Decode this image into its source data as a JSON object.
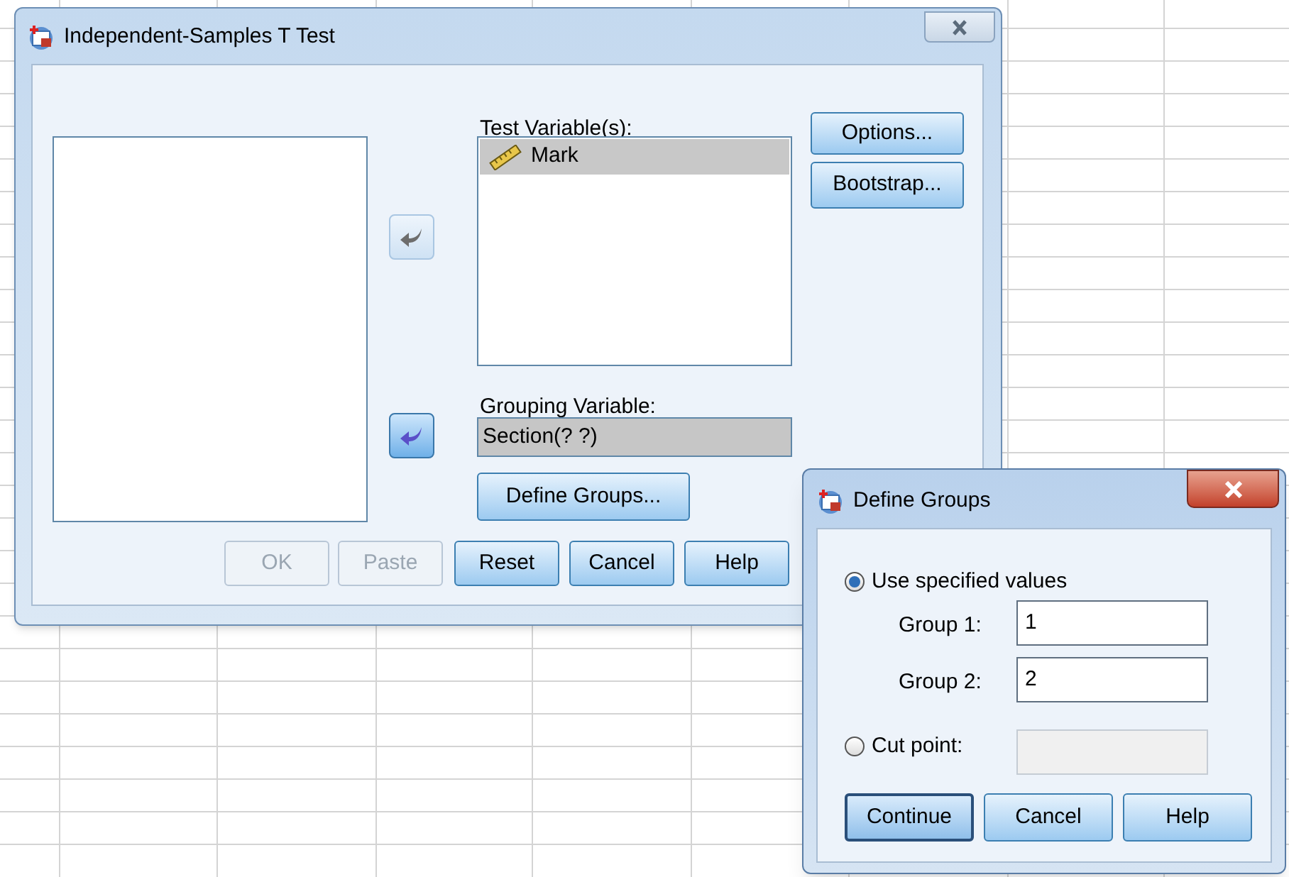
{
  "main_dialog": {
    "title": "Independent-Samples T Test",
    "test_variables": {
      "label": "Test Variable(s):",
      "items": [
        {
          "name": "Mark",
          "selected": true
        }
      ]
    },
    "move_buttons": [
      {
        "disabled": true
      },
      {
        "disabled": false
      }
    ],
    "side_buttons": [
      {
        "label": "Options..."
      },
      {
        "label": "Bootstrap..."
      }
    ],
    "grouping_variable": {
      "label": "Grouping Variable:",
      "value": "Section(? ?)"
    },
    "define_groups_button": {
      "label": "Define Groups..."
    },
    "buttons": [
      {
        "label": "OK",
        "disabled": true
      },
      {
        "label": "Paste",
        "disabled": true
      },
      {
        "label": "Reset",
        "disabled": false
      },
      {
        "label": "Cancel",
        "disabled": false
      },
      {
        "label": "Help",
        "disabled": false
      }
    ]
  },
  "define_groups_dialog": {
    "title": "Define Groups",
    "use_specified": {
      "label": "Use specified values",
      "selected": true
    },
    "groups": [
      {
        "label": "Group 1:",
        "value": "1"
      },
      {
        "label": "Group 2:",
        "value": "2"
      }
    ],
    "cut_point": {
      "label": "Cut point:",
      "selected": false
    },
    "buttons": [
      {
        "label": "Continue",
        "focused": true
      },
      {
        "label": "Cancel",
        "focused": false
      },
      {
        "label": "Help",
        "focused": false
      }
    ]
  }
}
